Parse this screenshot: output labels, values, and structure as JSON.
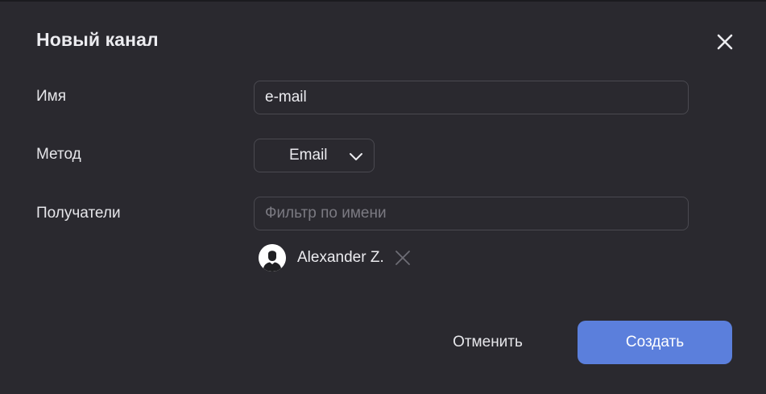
{
  "dialog": {
    "title": "Новый канал"
  },
  "form": {
    "name": {
      "label": "Имя",
      "value": "e-mail"
    },
    "method": {
      "label": "Метод",
      "selected": "Email"
    },
    "recipients": {
      "label": "Получатели",
      "placeholder": "Фильтр по имени",
      "items": [
        {
          "name": "Alexander Z."
        }
      ]
    }
  },
  "actions": {
    "cancel_label": "Отменить",
    "submit_label": "Создать"
  },
  "colors": {
    "background": "#2a292f",
    "accent": "#5b7fdc",
    "border": "#4a4950"
  },
  "icons": {
    "close": "close-icon",
    "chevron": "chevron-down-icon",
    "avatar": "user-silhouette-icon",
    "remove": "remove-icon"
  }
}
